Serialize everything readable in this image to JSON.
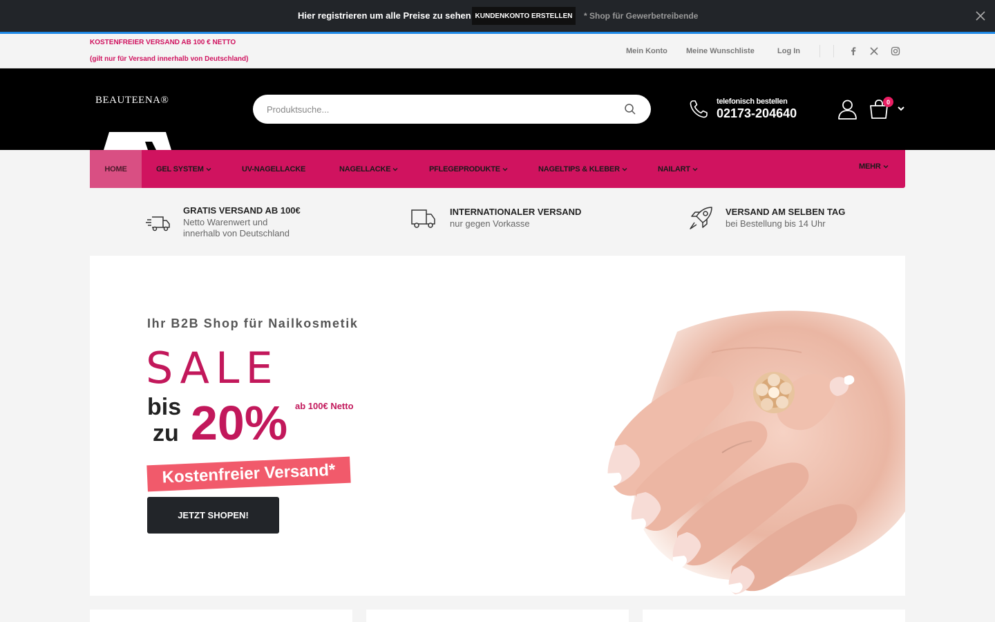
{
  "promo": {
    "text": "Hier registrieren um alle Preise zu sehen",
    "button": "KUNDENKONTO ERSTELLEN",
    "note": "* Shop für Gewerbetreibende"
  },
  "topbar": {
    "shipping_line1": "KOSTENFREIER VERSAND AB 100 € NETTO",
    "shipping_line2": "(gilt nur für Versand innerhalb von Deutschland)",
    "links": [
      "Mein Konto",
      "Meine Wunschliste",
      "Log In"
    ]
  },
  "header": {
    "logo": "BEAUTEENA®",
    "search_placeholder": "Produktsuche...",
    "phone_label": "telefonisch bestellen",
    "phone_number": "02173-204640",
    "cart_count": "0"
  },
  "nav": {
    "items": [
      "HOME",
      "GEL SYSTEM",
      "UV-NAGELLACKE",
      "NAGELLACKE",
      "PFLEGEPRODUKTE",
      "NAGELTIPS & KLEBER",
      "NAILART",
      "MEHR"
    ]
  },
  "features": [
    {
      "title": "GRATIS VERSAND AB 100€",
      "line1": "Netto Warenwert und",
      "line2": "innerhalb von Deutschland",
      "icon": "truck-fast-icon"
    },
    {
      "title": "INTERNATIONALER VERSAND",
      "line1": "nur gegen Vorkasse",
      "icon": "truck-icon"
    },
    {
      "title": "VERSAND AM SELBEN TAG",
      "line1": "bei Bestellung bis 14 Uhr",
      "icon": "rocket-icon"
    }
  ],
  "hero": {
    "subtitle": "Ihr B2B Shop für Nailkosmetik",
    "sale": "SALE",
    "bis": "bis",
    "zu": "zu",
    "percent": "20%",
    "netto": "ab 100€ Netto",
    "banner": "Kostenfreier Versand*",
    "button": "JETZT SHOPEN!"
  },
  "colors": {
    "brand": "#d0135f",
    "dark": "#222529",
    "accent_blue": "#1e88e5",
    "banner_red": "#f15a6b"
  }
}
